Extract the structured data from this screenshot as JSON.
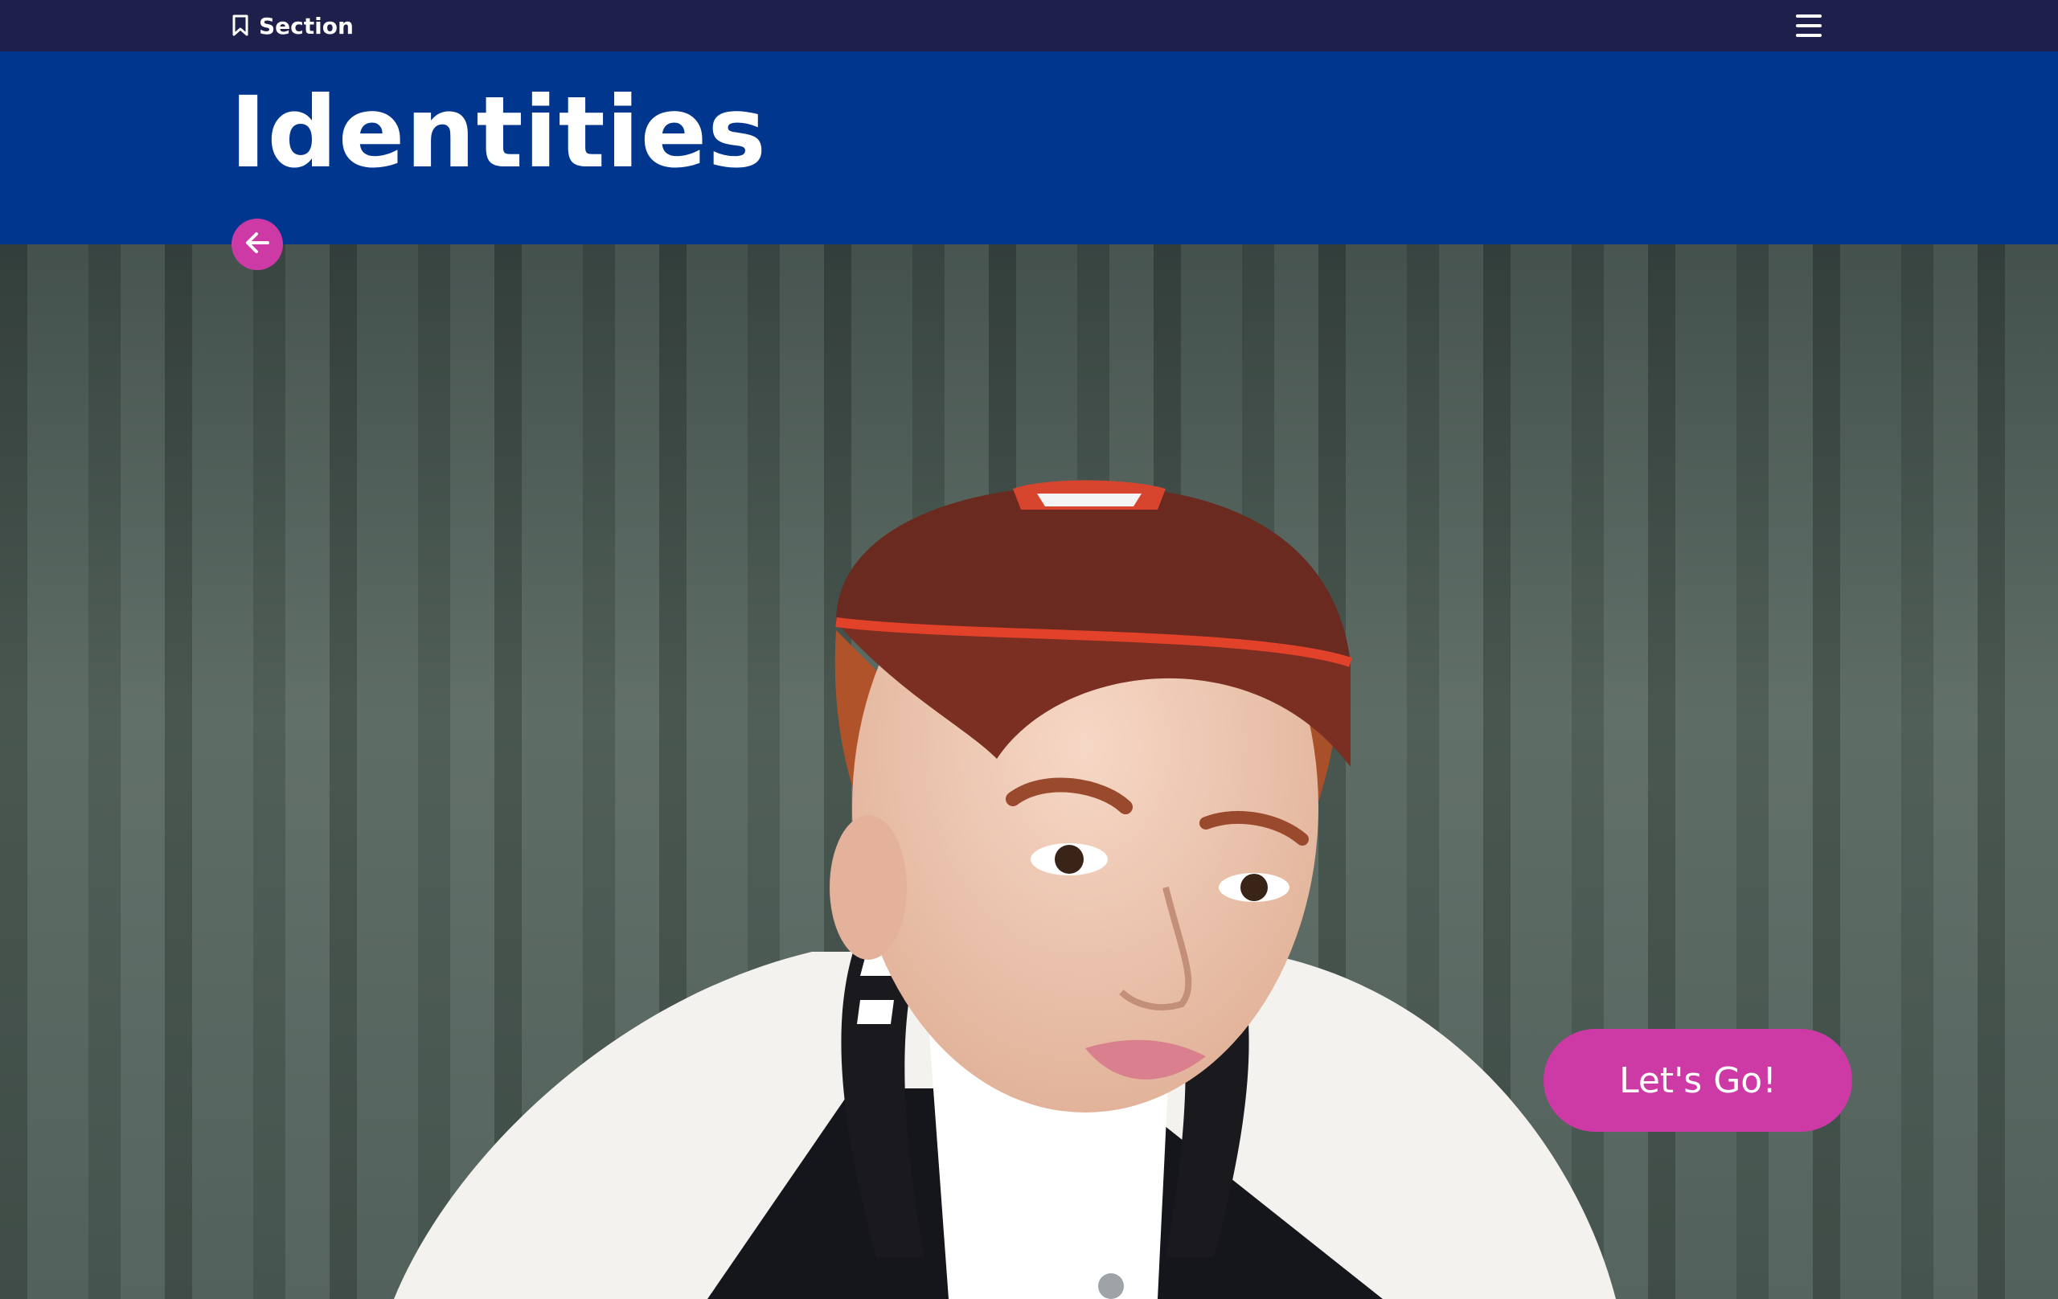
{
  "topbar": {
    "section_label": "Section",
    "section_icon": "bookmark-icon",
    "menu_icon": "hamburger-menu-icon"
  },
  "header": {
    "title": "Identities"
  },
  "hero": {
    "image_subject": "portrait of a young person wearing a red cap and varsity jacket",
    "back_icon": "arrow-left-icon",
    "cta_label": "Let's Go!"
  },
  "colors": {
    "topbar_bg": "#1e1f4b",
    "header_bg": "#00368e",
    "accent": "#cd3aa5",
    "text": "#ffffff"
  }
}
